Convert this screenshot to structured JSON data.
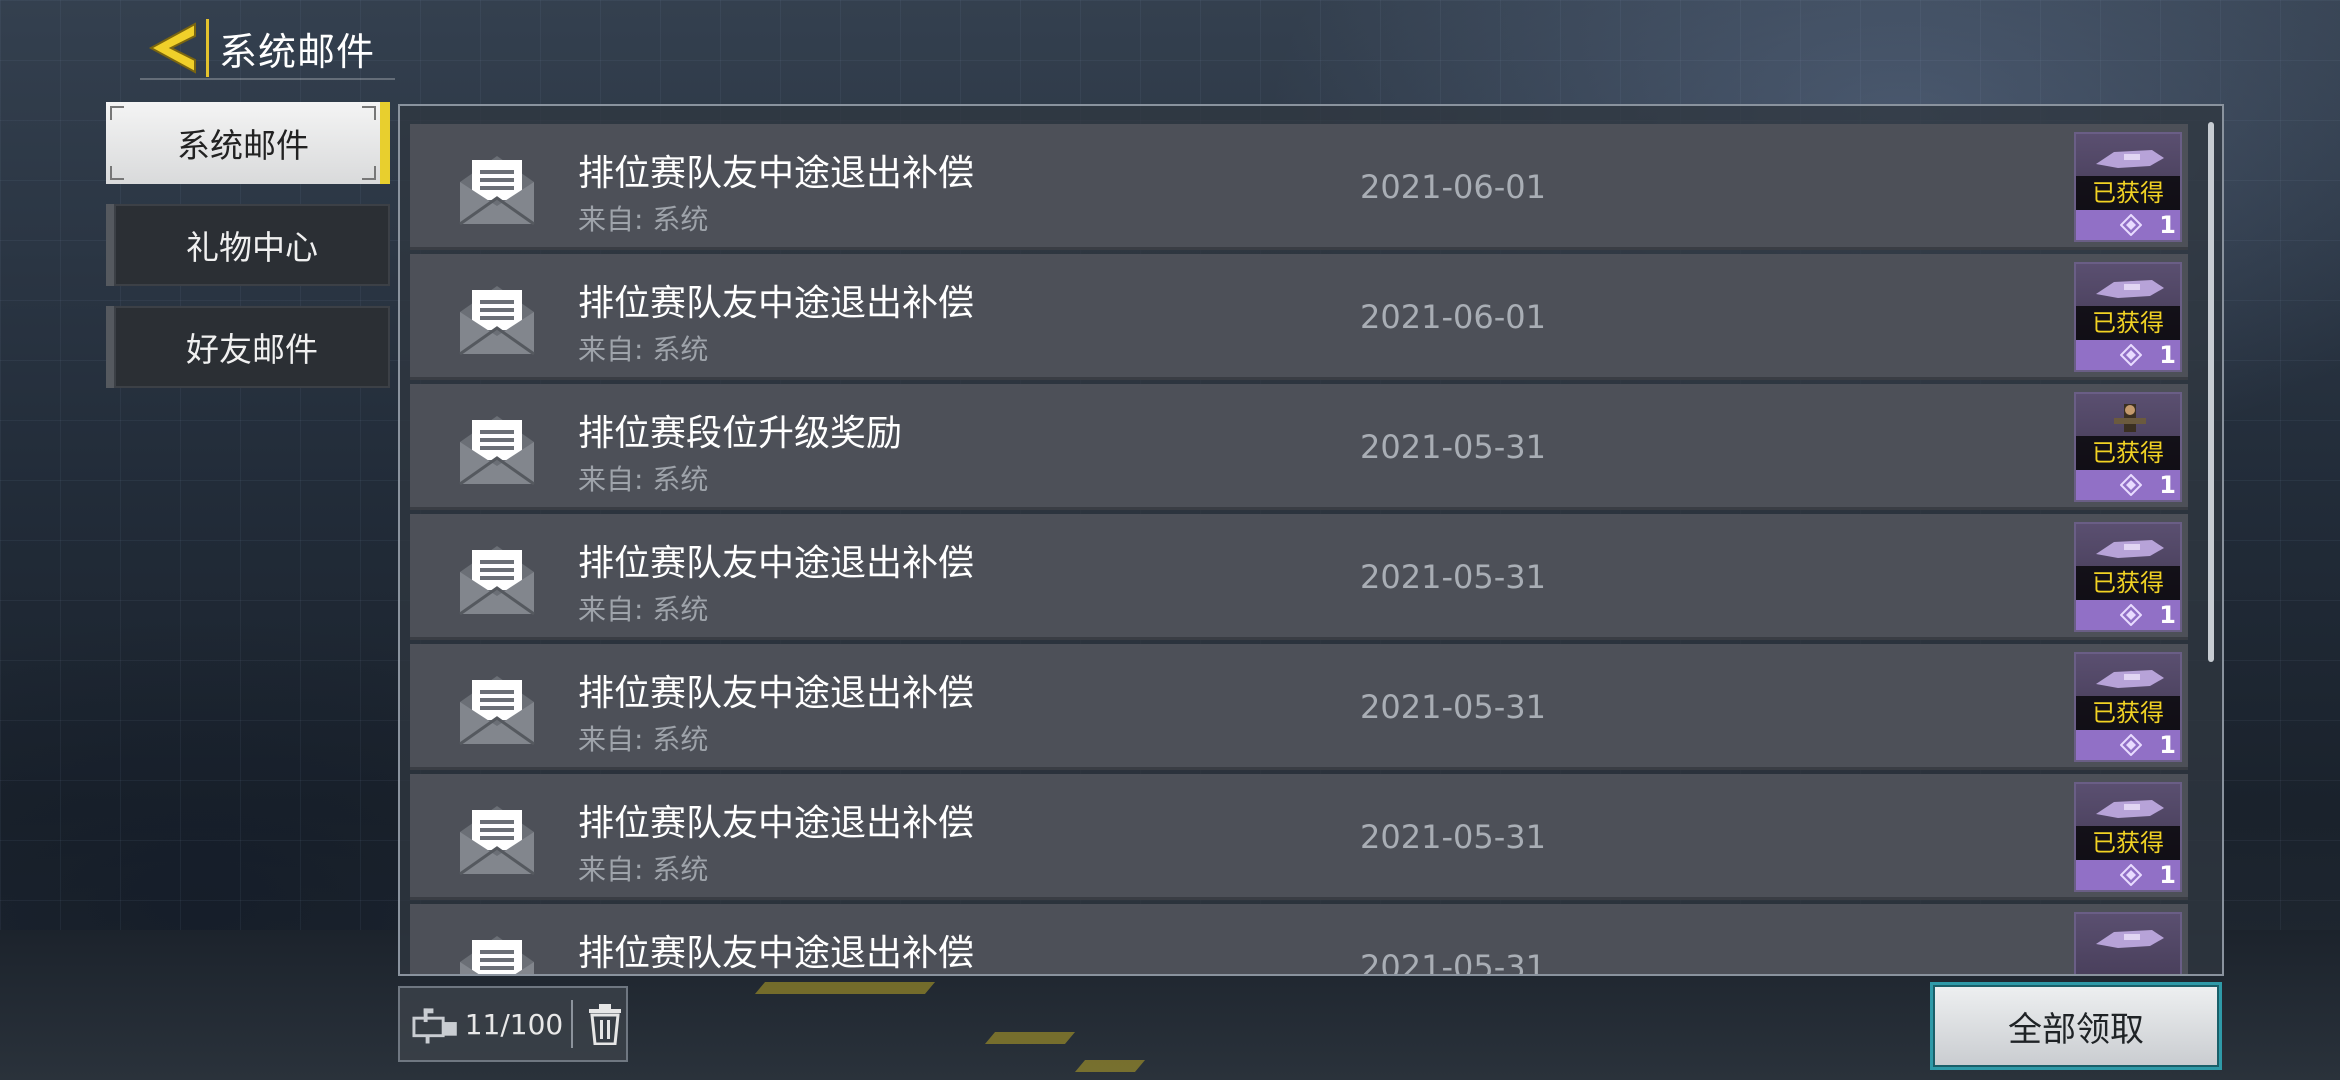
{
  "header": {
    "title": "系统邮件",
    "back_icon": "back-arrow-icon",
    "accent_color": "#e3c22e"
  },
  "tabs": [
    {
      "label": "系统邮件",
      "active": true
    },
    {
      "label": "礼物中心",
      "active": false
    },
    {
      "label": "好友邮件",
      "active": false
    }
  ],
  "mails": [
    {
      "subject": "排位赛队友中途退出补偿",
      "from": "来自: 系统",
      "date": "2021-06-01",
      "reward_status": "已获得",
      "reward_count": "1",
      "icon": "envelope-open-icon"
    },
    {
      "subject": "排位赛队友中途退出补偿",
      "from": "来自: 系统",
      "date": "2021-06-01",
      "reward_status": "已获得",
      "reward_count": "1",
      "icon": "envelope-open-icon"
    },
    {
      "subject": "排位赛段位升级奖励",
      "from": "来自: 系统",
      "date": "2021-05-31",
      "reward_status": "已获得",
      "reward_count": "1",
      "icon": "envelope-open-icon"
    },
    {
      "subject": "排位赛队友中途退出补偿",
      "from": "来自: 系统",
      "date": "2021-05-31",
      "reward_status": "已获得",
      "reward_count": "1",
      "icon": "envelope-open-icon"
    },
    {
      "subject": "排位赛队友中途退出补偿",
      "from": "来自: 系统",
      "date": "2021-05-31",
      "reward_status": "已获得",
      "reward_count": "1",
      "icon": "envelope-open-icon"
    },
    {
      "subject": "排位赛队友中途退出补偿",
      "from": "来自: 系统",
      "date": "2021-05-31",
      "reward_status": "已获得",
      "reward_count": "1",
      "icon": "envelope-open-icon"
    },
    {
      "subject": "排位赛队友中途退出补偿",
      "from": "",
      "date": "2021-05-31",
      "reward_status": "",
      "reward_count": "",
      "icon": "envelope-open-icon"
    }
  ],
  "storage": {
    "count": "11/100",
    "icon": "mailbox-icon",
    "delete_icon": "trash-icon"
  },
  "claim_all": {
    "label": "全部领取",
    "border_color": "#2f9aa8"
  },
  "colors": {
    "reward_badge_text": "#f1d223",
    "reward_count_bar": "#9170c6",
    "row_bg": "#4d5058"
  }
}
